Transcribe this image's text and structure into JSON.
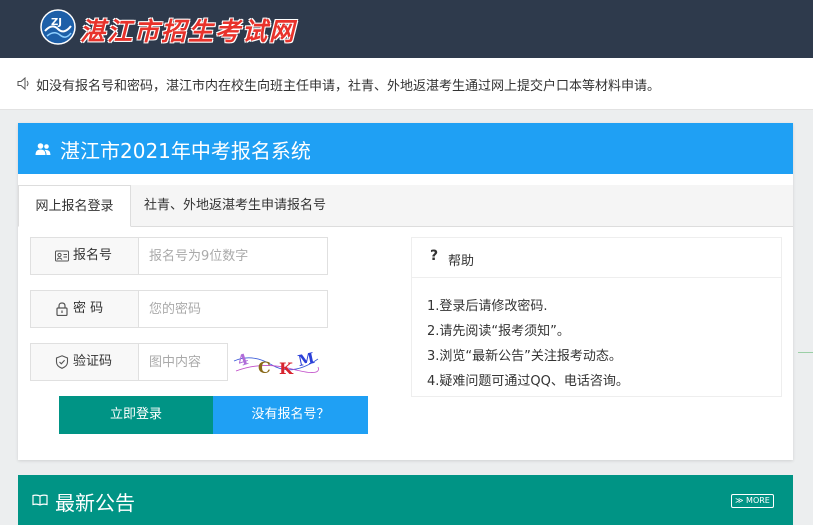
{
  "header": {
    "site_name": "湛江市招生考试网",
    "logo_icon": "zj-emblem-icon"
  },
  "notice": {
    "icon": "speaker-icon",
    "text": "如没有报名号和密码，湛江市内在校生向班主任申请，社青、外地返湛考生通过网上提交户口本等材料申请。"
  },
  "panel": {
    "icon": "users-icon",
    "title": "湛江市2021年中考报名系统",
    "tabs": [
      {
        "label": "网上报名登录",
        "active": true
      },
      {
        "label": "社青、外地返湛考生申请报名号",
        "active": false
      }
    ],
    "form": {
      "reg_label": "报名号",
      "reg_placeholder": "报名号为9位数字",
      "reg_icon": "id-card-icon",
      "pwd_label": "密 码",
      "pwd_placeholder": "您的密码",
      "pwd_icon": "lock-icon",
      "captcha_label": "验证码",
      "captcha_placeholder": "图中内容",
      "captcha_icon": "shield-icon",
      "captcha_text": "4CKM"
    },
    "buttons": {
      "login": "立即登录",
      "no_reg": "没有报名号？"
    },
    "help": {
      "mark": "?",
      "title": "帮助",
      "items": [
        "1.登录后请修改密码.",
        "2.请先阅读“报考须知”。",
        "3.浏览“最新公告”关注报考动态。",
        "4.疑难问题可通过QQ、电话咨询。"
      ]
    }
  },
  "news": {
    "icon": "book-icon",
    "title": "最新公告",
    "more": "≫ MORE"
  },
  "colors": {
    "topbar": "#2e3a4c",
    "blue": "#1fa0f4",
    "teal": "#009485",
    "logo_text": "#e8322b"
  }
}
